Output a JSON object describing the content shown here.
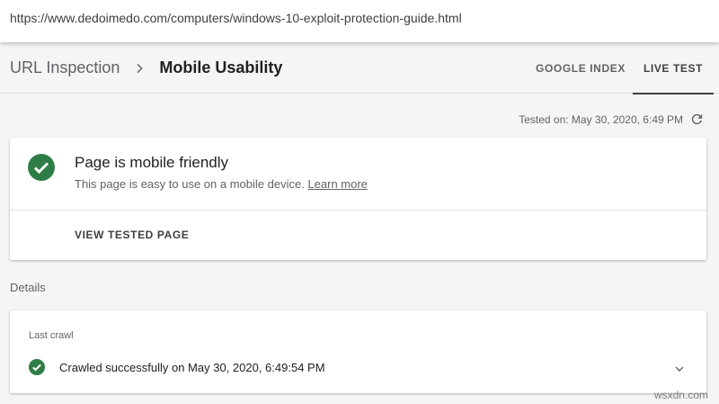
{
  "address_bar": {
    "url": "https://www.dedoimedo.com/computers/windows-10-exploit-protection-guide.html"
  },
  "header": {
    "breadcrumb_root": "URL Inspection",
    "breadcrumb_current": "Mobile Usability",
    "tabs": [
      {
        "label": "GOOGLE INDEX",
        "active": false
      },
      {
        "label": "LIVE TEST",
        "active": true
      }
    ]
  },
  "test_info": {
    "tested_on": "Tested on: May 30, 2020, 6:49 PM"
  },
  "result_card": {
    "title": "Page is mobile friendly",
    "description": "This page is easy to use on a mobile device.",
    "learn_more": "Learn more",
    "view_tested_page": "VIEW TESTED PAGE",
    "status_icon": "check-circle-icon",
    "status_color": "#2e7d46"
  },
  "details": {
    "label": "Details",
    "last_crawl_label": "Last crawl",
    "crawl_status": "Crawled successfully on May 30, 2020, 6:49:54 PM"
  },
  "watermark": "wsxdn.com"
}
